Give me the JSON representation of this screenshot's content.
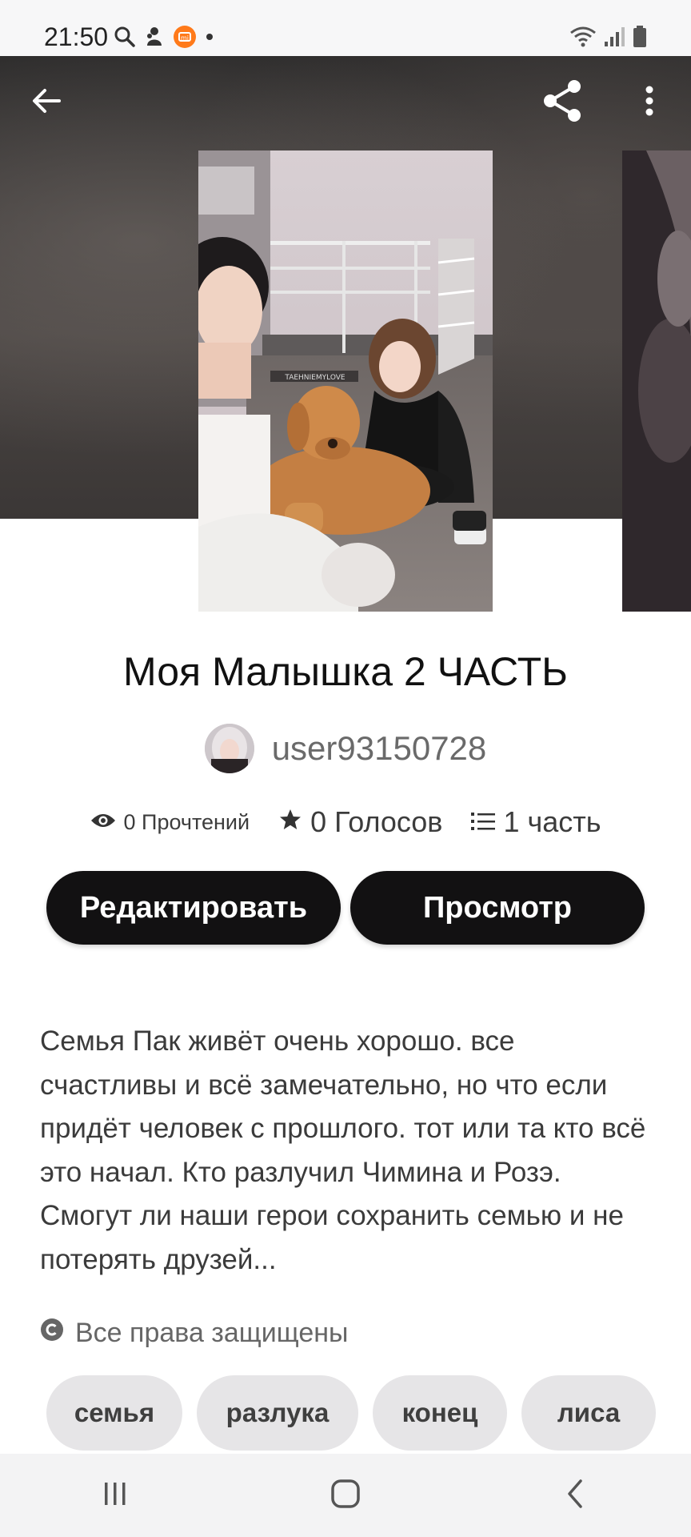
{
  "status_bar": {
    "time": "21:50",
    "left_icons": [
      "search-icon",
      "notification-icon",
      "mi-app-icon",
      "dot-icon"
    ],
    "right_icons": [
      "wifi-icon",
      "signal-icon",
      "battery-icon"
    ]
  },
  "header": {
    "back_icon": "arrow-left-icon",
    "share_icon": "share-icon",
    "menu_icon": "more-vertical-icon",
    "cover_watermark": "TAEHNIEMYLOVE"
  },
  "story": {
    "title": "Моя Малышка 2 ЧАСТЬ",
    "author": "user93150728",
    "reads": "0 Прочтений",
    "votes": "0 Голосов",
    "parts": "1 часть",
    "description": "Семья Пак живёт очень хорошо. все счастливы и всё замечательно, но что если придёт человек с прошлого. тот или та кто всё это начал. Кто разлучил Чимина и Розэ. Смогут ли наши герои сохранить семью и не потерять друзей...",
    "copyright": "Все права защищены"
  },
  "actions": {
    "edit_label": "Редактировать",
    "preview_label": "Просмотр"
  },
  "tags": [
    "семья",
    "разлука",
    "конец",
    "лиса"
  ],
  "nav": {
    "recent_icon": "recent-apps-icon",
    "home_icon": "home-icon",
    "back_icon": "nav-back-icon"
  },
  "colors": {
    "button_bg": "#121112",
    "tag_bg": "#e6e5e7",
    "hero_bg": "#3d3a39"
  }
}
